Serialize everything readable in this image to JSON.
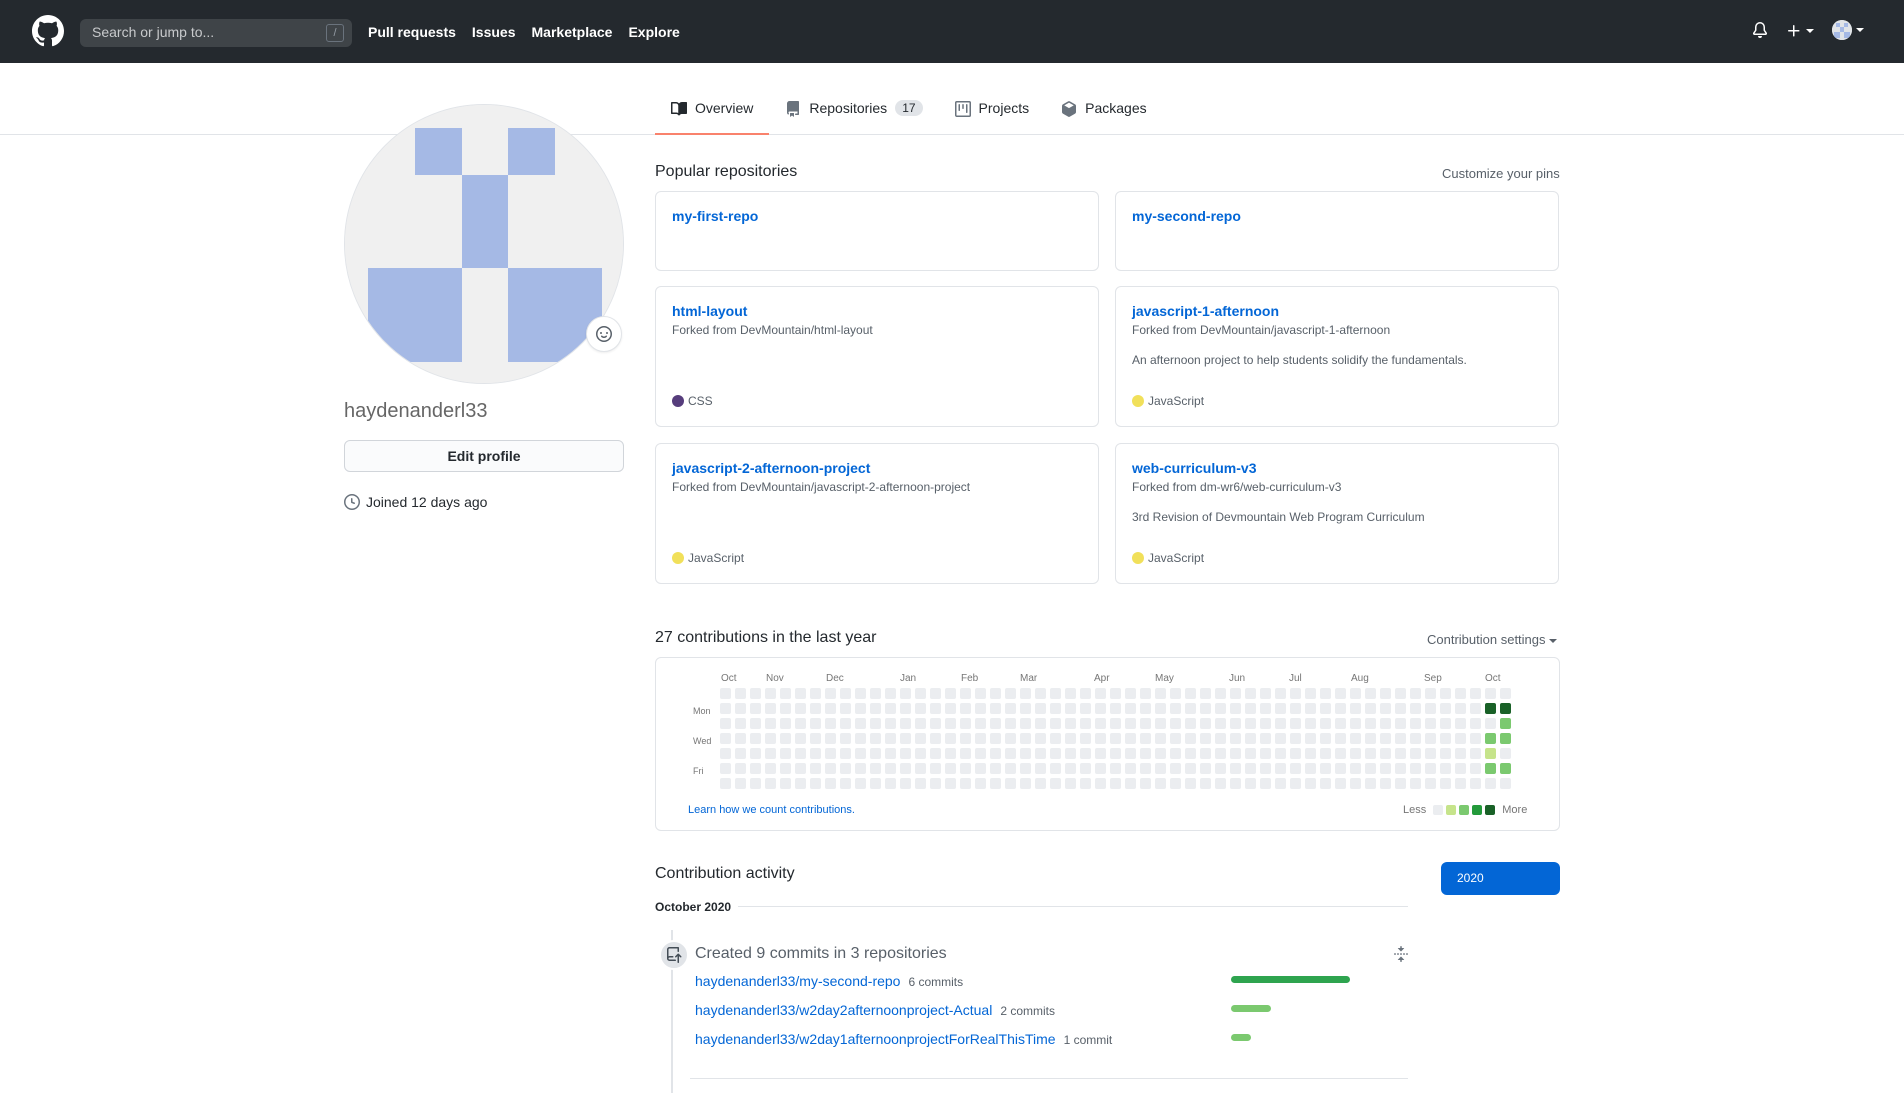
{
  "nav": {
    "search_placeholder": "Search or jump to...",
    "search_shortcut": "/",
    "links": [
      "Pull requests",
      "Issues",
      "Marketplace",
      "Explore"
    ]
  },
  "tabs": {
    "overview": "Overview",
    "repositories": "Repositories",
    "repositories_count": "17",
    "projects": "Projects",
    "packages": "Packages"
  },
  "profile": {
    "username": "haydenanderl33",
    "edit_label": "Edit profile",
    "joined": "Joined 12 days ago"
  },
  "popular": {
    "title": "Popular repositories",
    "customize": "Customize your pins",
    "repos": [
      {
        "name": "my-first-repo",
        "fork": "",
        "desc": "",
        "lang": "",
        "lang_color": ""
      },
      {
        "name": "my-second-repo",
        "fork": "",
        "desc": "",
        "lang": "",
        "lang_color": ""
      },
      {
        "name": "html-layout",
        "fork": "Forked from DevMountain/html-layout",
        "desc": "",
        "lang": "CSS",
        "lang_color": "#563d7c"
      },
      {
        "name": "javascript-1-afternoon",
        "fork": "Forked from DevMountain/javascript-1-afternoon",
        "desc": "An afternoon project to help students solidify the fundamentals.",
        "lang": "JavaScript",
        "lang_color": "#f1e05a"
      },
      {
        "name": "javascript-2-afternoon-project",
        "fork": "Forked from DevMountain/javascript-2-afternoon-project",
        "desc": "",
        "lang": "JavaScript",
        "lang_color": "#f1e05a"
      },
      {
        "name": "web-curriculum-v3",
        "fork": "Forked from dm-wr6/web-curriculum-v3",
        "desc": "3rd Revision of Devmountain Web Program Curriculum",
        "lang": "JavaScript",
        "lang_color": "#f1e05a"
      }
    ]
  },
  "contributions": {
    "title": "27 contributions in the last year",
    "settings": "Contribution settings",
    "months": [
      "Oct",
      "Nov",
      "Dec",
      "Jan",
      "Feb",
      "Mar",
      "Apr",
      "May",
      "Jun",
      "Jul",
      "Aug",
      "Sep",
      "Oct"
    ],
    "days": [
      "Mon",
      "Wed",
      "Fri"
    ],
    "learn": "Learn how we count contributions.",
    "less": "Less",
    "more": "More",
    "colors": [
      "#ebedf0",
      "#c6e48b",
      "#7bc96f",
      "#239a3b",
      "#196127"
    ]
  },
  "activity": {
    "title": "Contribution activity",
    "year": "2020",
    "month": "October 2020",
    "created": "Created 9 commits in 3 repositories",
    "rows": [
      {
        "repo": "haydenanderl33/my-second-repo",
        "count": "6 commits",
        "value": 6,
        "color": "#2ea44f"
      },
      {
        "repo": "haydenanderl33/w2day2afternoonproject-Actual",
        "count": "2 commits",
        "value": 2,
        "color": "#7bc96f"
      },
      {
        "repo": "haydenanderl33/w2day1afternoonprojectForRealThisTime",
        "count": "1 commit",
        "value": 1,
        "color": "#7bc96f"
      }
    ]
  }
}
